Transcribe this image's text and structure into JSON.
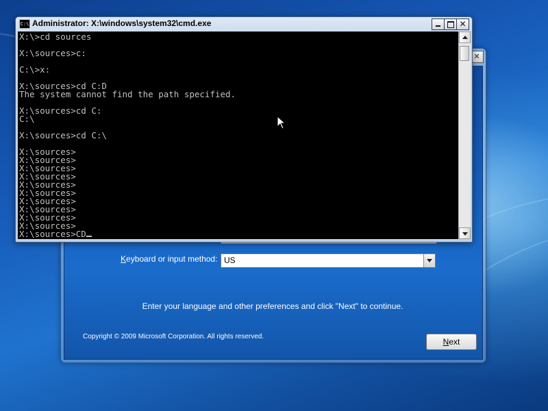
{
  "cmd_window": {
    "title": "Administrator: X:\\windows\\system32\\cmd.exe",
    "icon_label": "C:\\",
    "icon": "console-icon",
    "lines": [
      "X:\\>cd sources",
      "",
      "X:\\sources>c:",
      "",
      "C:\\>x:",
      "",
      "X:\\sources>cd C:D",
      "The system cannot find the path specified.",
      "",
      "X:\\sources>cd C:",
      "C:\\",
      "",
      "X:\\sources>cd C:\\",
      "",
      "X:\\sources>",
      "X:\\sources>",
      "X:\\sources>",
      "X:\\sources>",
      "X:\\sources>",
      "X:\\sources>",
      "X:\\sources>",
      "X:\\sources>",
      "X:\\sources>",
      "X:\\sources>"
    ],
    "input_line": "X:\\sources>CD",
    "buttons": {
      "minimize": "minimize-icon",
      "maximize": "maximize-icon",
      "close": "close-icon"
    }
  },
  "setup_window": {
    "close_glyph": "✕",
    "keyboard_label_accel": "K",
    "keyboard_label_rest": "eyboard or input method:",
    "keyboard_value": "US",
    "instruction": "Enter your language and other preferences and click \"Next\" to continue.",
    "copyright": "Copyright © 2009 Microsoft Corporation. All rights reserved.",
    "next_accel": "N",
    "next_rest": "ext"
  },
  "colors": {
    "console_bg": "#000000",
    "console_fg": "#c0c0c0",
    "desktop_blue": "#1658b5"
  }
}
